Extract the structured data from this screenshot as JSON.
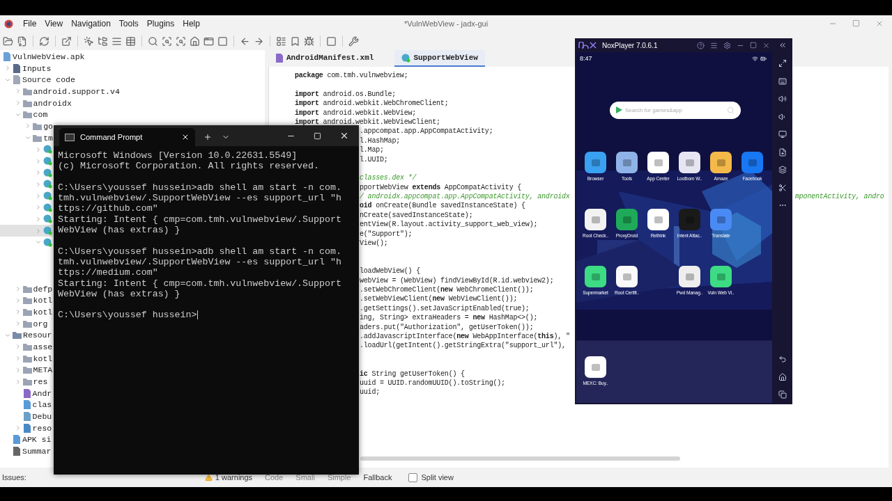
{
  "ide": {
    "title": "*VulnWebView - jadx-gui",
    "menu": [
      "File",
      "View",
      "Navigation",
      "Tools",
      "Plugins",
      "Help"
    ],
    "tree": {
      "label": "VulnWebView.apk",
      "kind": "apk",
      "selected": false,
      "children": [
        {
          "label": "Inputs",
          "kind": "inputs",
          "expanded": false,
          "selected": false
        },
        {
          "label": "Source code",
          "kind": "source",
          "expanded": true,
          "selected": false,
          "children": [
            {
              "label": "android.support.v4",
              "kind": "package",
              "expanded": false,
              "selected": false
            },
            {
              "label": "androidx",
              "kind": "package",
              "expanded": false,
              "selected": false
            },
            {
              "label": "com",
              "kind": "package",
              "expanded": true,
              "selected": false,
              "children": [
                {
                  "label": "go",
                  "kind": "package",
                  "expanded": false,
                  "selected": false
                },
                {
                  "label": "tm",
                  "kind": "package",
                  "expanded": true,
                  "selected": false,
                  "children": [
                    {
                      "kind": "class",
                      "expanded": false,
                      "selected": false
                    },
                    {
                      "kind": "class",
                      "expanded": false,
                      "selected": false
                    },
                    {
                      "kind": "class",
                      "expanded": false,
                      "selected": false
                    },
                    {
                      "kind": "class",
                      "expanded": false,
                      "selected": false
                    },
                    {
                      "kind": "class",
                      "expanded": false,
                      "selected": false
                    },
                    {
                      "kind": "class",
                      "expanded": false,
                      "selected": false
                    },
                    {
                      "kind": "class",
                      "expanded": false,
                      "selected": false
                    },
                    {
                      "kind": "class",
                      "expanded": false,
                      "selected": true
                    },
                    {
                      "kind": "class",
                      "expanded": true,
                      "selected": false
                    }
                  ]
                }
              ]
            },
            {
              "label": "defp",
              "kind": "package",
              "expanded": false,
              "selected": false
            },
            {
              "label": "kotl",
              "kind": "package",
              "expanded": false,
              "selected": false
            },
            {
              "label": "kotl",
              "kind": "package",
              "expanded": false,
              "selected": false
            },
            {
              "label": "org",
              "kind": "package",
              "expanded": false,
              "selected": false
            }
          ]
        },
        {
          "label": "Resour",
          "kind": "resources",
          "expanded": true,
          "selected": false,
          "children": [
            {
              "label": "asse",
              "kind": "folder",
              "expanded": false,
              "selected": false
            },
            {
              "label": "kotl",
              "kind": "folder",
              "expanded": false,
              "selected": false
            },
            {
              "label": "META",
              "kind": "folder",
              "expanded": false,
              "selected": false
            },
            {
              "label": "res",
              "kind": "folder",
              "expanded": false,
              "selected": false
            },
            {
              "label": "Andr",
              "kind": "manifest",
              "selected": false
            },
            {
              "label": "clas",
              "kind": "dex",
              "selected": false
            },
            {
              "label": "Debu",
              "kind": "debug",
              "selected": false
            },
            {
              "label": "reso",
              "kind": "restable",
              "expanded": false,
              "selected": false
            }
          ]
        },
        {
          "label": "APK si",
          "kind": "signature",
          "selected": false
        },
        {
          "label": "Summar",
          "kind": "summary",
          "selected": false
        }
      ]
    },
    "tabs": [
      {
        "label": "AndroidManifest.xml",
        "kind": "manifest",
        "selected": false
      },
      {
        "label": "SupportWebView",
        "kind": "class",
        "selected": true
      }
    ],
    "code": [
      {
        "kind": "code",
        "text": "**package** com.tmh.vulnwebview;"
      },
      {
        "kind": "blank"
      },
      {
        "kind": "code",
        "text": "**import** android.os.Bundle;"
      },
      {
        "kind": "code",
        "text": "**import** android.webkit.WebChromeClient;"
      },
      {
        "kind": "code",
        "text": "**import** android.webkit.WebView;"
      },
      {
        "kind": "code",
        "text": "**import** android.webkit.WebViewClient;"
      },
      {
        "kind": "clipped",
        "text": ".appcompat.app.AppCompatActivity;"
      },
      {
        "kind": "clipped",
        "text": "l.HashMap;"
      },
      {
        "kind": "clipped",
        "text": "l.Map;"
      },
      {
        "kind": "clipped",
        "text": "l.UUID;"
      },
      {
        "kind": "blank"
      },
      {
        "kind": "comment",
        "text": "classes.dex */"
      },
      {
        "kind": "clipped",
        "text": "pportWebView **extends** AppCompatActivity {"
      },
      {
        "kind": "comment",
        "text": "/ androidx.appcompat.app.AppCompatActivity, androidx",
        "tail": "mponentActivity, andro"
      },
      {
        "kind": "clipped",
        "text": "**oid** onCreate(Bundle savedInstanceState) {"
      },
      {
        "kind": "clipped",
        "text": "nCreate(savedInstanceState);"
      },
      {
        "kind": "clipped",
        "text": "entView(R.layout.activity_support_web_view);"
      },
      {
        "kind": "clipped",
        "text": "e(\"Support\");"
      },
      {
        "kind": "clipped",
        "text": "View();"
      },
      {
        "kind": "blank"
      },
      {
        "kind": "blank"
      },
      {
        "kind": "clipped",
        "text": "loadWebView() {"
      },
      {
        "kind": "clipped",
        "text": "webView = (WebView) findViewById(R.id.webview2);"
      },
      {
        "kind": "clipped",
        "text": ".setWebChromeClient(**new** WebChromeClient());"
      },
      {
        "kind": "clipped",
        "text": ".setWebViewClient(**new** WebViewClient());"
      },
      {
        "kind": "clipped",
        "text": ".getSettings().setJavaScriptEnabled(true);"
      },
      {
        "kind": "clipped",
        "text": "ing, String> extraHeaders = **new** HashMap<>();"
      },
      {
        "kind": "clipped",
        "text": "aders.put(\"Authorization\", getUserToken());"
      },
      {
        "kind": "clipped",
        "text": ".addJavascriptInterface(**new** WebAppInterface(**this**), \""
      },
      {
        "kind": "clipped",
        "text": ".loadUrl(getIntent().getStringExtra(\"support_url\"),"
      },
      {
        "kind": "blank"
      },
      {
        "kind": "blank"
      },
      {
        "kind": "clipped",
        "text": "**ic** String getUserToken() {"
      },
      {
        "kind": "clipped",
        "text": "uuid = UUID.randomUUID().toString();"
      },
      {
        "kind": "clipped",
        "text": "uuid;"
      }
    ],
    "view_modes": [
      "Code",
      "Smali",
      "Simple",
      "Fallback"
    ],
    "split_view": {
      "label": "Split view",
      "checked": false
    },
    "status": {
      "issues": "Issues:",
      "warnings": "1 warnings"
    }
  },
  "terminal": {
    "title": "Command Prompt",
    "blocks": [
      [
        "Microsoft Windows [Version 10.0.22631.5549]",
        "(c) Microsoft Corporation. All rights reserved."
      ],
      [
        "C:\\Users\\youssef hussein>adb shell am start -n com.",
        "tmh.vulnwebview/.SupportWebView --es support_url \"h",
        "ttps://github.com\"",
        "Starting: Intent { cmp=com.tmh.vulnwebview/.Support",
        "WebView (has extras) }"
      ],
      [
        "C:\\Users\\youssef hussein>adb shell am start -n com.",
        "tmh.vulnwebview/.SupportWebView --es support_url \"h",
        "ttps://medium.com\"",
        "Starting: Intent { cmp=com.tmh.vulnwebview/.Support",
        "WebView (has extras) }"
      ],
      [
        "C:\\Users\\youssef hussein>"
      ]
    ]
  },
  "emulator": {
    "title": "NoxPlayer 7.0.6.1",
    "time": "8:47",
    "search": {
      "placeholder": "Search for games&app"
    },
    "apps": [
      {
        "kind": "app",
        "label": "Browser",
        "color": "#3aa0f0"
      },
      {
        "kind": "app",
        "label": "Tools",
        "color": "#8fb3e8"
      },
      {
        "kind": "app",
        "label": "App Center",
        "color": "#ffffff"
      },
      {
        "kind": "app",
        "label": "Lootbom W..",
        "color": "#e6e6f2"
      },
      {
        "kind": "app",
        "label": "Amaze",
        "color": "#f5b94a"
      },
      {
        "kind": "app",
        "label": "Facebook",
        "color": "#1877f2"
      },
      {
        "kind": "app",
        "label": "Root Check..",
        "color": "#f2f2f2"
      },
      {
        "kind": "app",
        "label": "ProxyDroid",
        "color": "#1faa59"
      },
      {
        "kind": "app",
        "label": "Rethink",
        "color": "#ffffff"
      },
      {
        "kind": "app",
        "label": "Intent Attac..",
        "color": "#1a1a1a"
      },
      {
        "kind": "app",
        "label": "Translate",
        "color": "#4a8af4"
      },
      {
        "kind": "empty"
      },
      {
        "kind": "app",
        "label": "Supermarket",
        "color": "#3ddc84"
      },
      {
        "kind": "app",
        "label": "Root Certifi..",
        "color": "#fafafa"
      },
      {
        "kind": "empty"
      },
      {
        "kind": "app",
        "label": "Pwd Manag..",
        "color": "#eeeeee"
      },
      {
        "kind": "app",
        "label": "Vuln Web Vi..",
        "color": "#3ddc84"
      }
    ],
    "dock": [
      {
        "label": "MEXC: Buy..",
        "color": "#ffffff"
      }
    ]
  }
}
